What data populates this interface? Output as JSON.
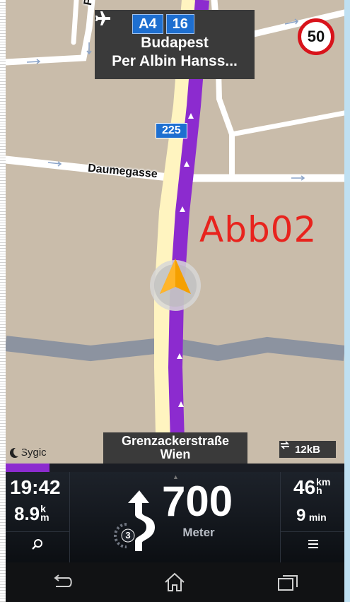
{
  "signpost": {
    "badge_a": "A4",
    "badge_b": "16",
    "airport_icon": "airplane-icon",
    "line1": "Budapest",
    "line2": "Per Albin Hanss..."
  },
  "speed_limit": "50",
  "streets": {
    "daumegasse": "Daumegasse",
    "partial": "Fa",
    "road_number": "225"
  },
  "annotation": "Abb02",
  "logo": "Sygic",
  "current_street": {
    "line1": "Grenzackerstraße",
    "line2": "Wien"
  },
  "data_usage": "12kB",
  "progress": {
    "fraction": 0.13
  },
  "left_panel": {
    "time": "19:42",
    "distance_value": "8.9",
    "distance_unit_top": "k",
    "distance_unit_bottom": "m"
  },
  "center_panel": {
    "distance": "700",
    "unit": "Meter",
    "exit_number": "3"
  },
  "right_panel": {
    "speed": "46",
    "speed_unit_top": "km",
    "speed_unit_bottom": "h",
    "duration": "9",
    "duration_unit": "min"
  },
  "colors": {
    "route": "#8c2bcf",
    "map_bg": "#c9bcaa",
    "panel": "#1d222a",
    "speed_ring": "#d8131b",
    "marker": "#f5a000"
  }
}
